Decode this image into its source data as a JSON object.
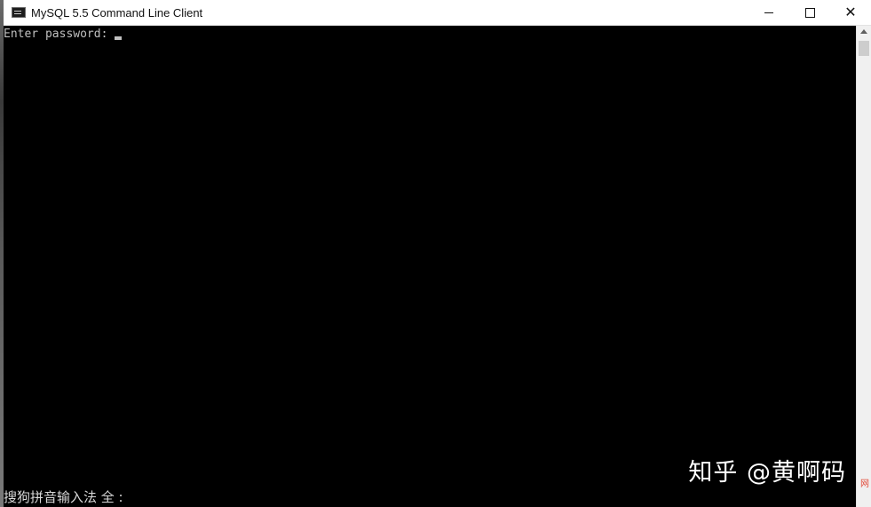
{
  "window": {
    "title": "MySQL 5.5 Command Line Client",
    "icon": "console-app-icon",
    "controls": {
      "minimize": "minimize-icon",
      "maximize": "maximize-icon",
      "close": "close-icon"
    },
    "close_glyph": "✕"
  },
  "console": {
    "prompt": "Enter password: ",
    "ime_status": "搜狗拼音输入法 全 :"
  },
  "watermark": {
    "text": "知乎 @黄啊码",
    "logo_text": "网"
  },
  "colors": {
    "console_bg": "#000000",
    "console_fg": "#c0c0c0",
    "titlebar_bg": "#ffffff"
  }
}
